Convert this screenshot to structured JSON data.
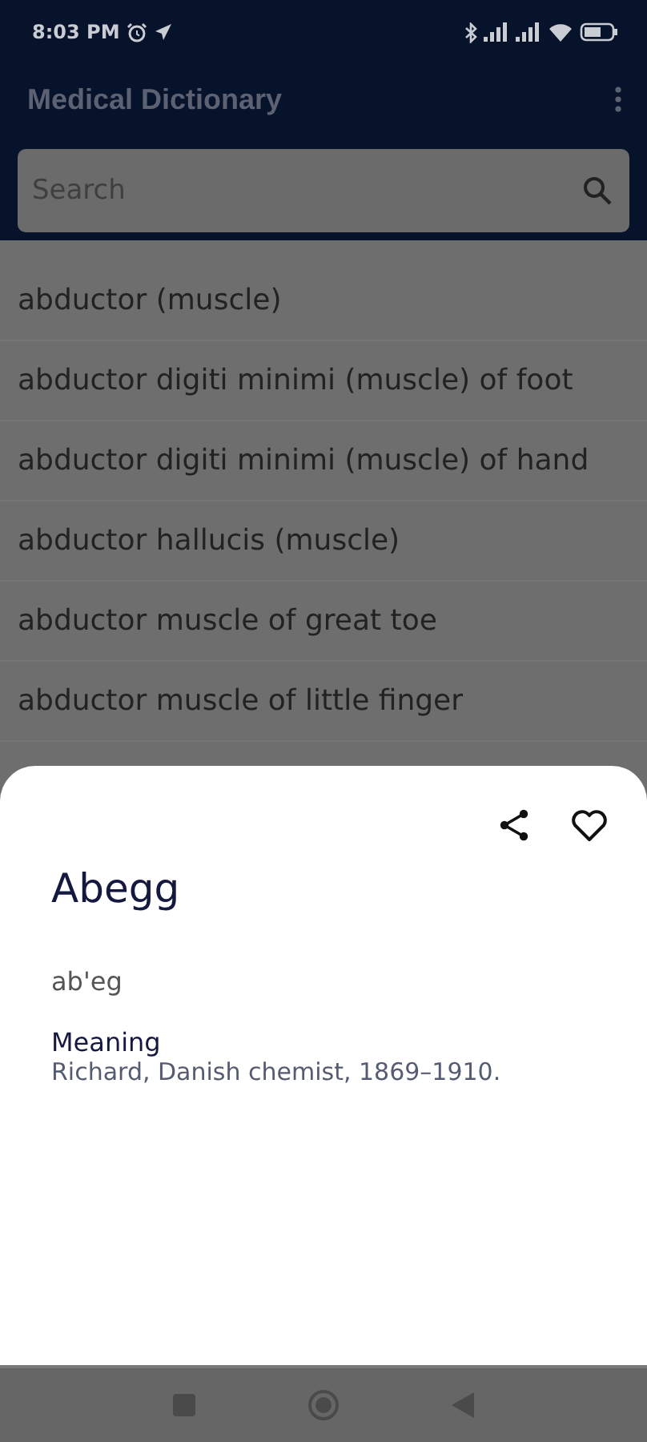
{
  "status_bar": {
    "time": "8:03 PM"
  },
  "app_bar": {
    "title": "Medical Dictionary"
  },
  "search": {
    "placeholder": "Search"
  },
  "entries": [
    "abductor (muscle)",
    "abductor digiti minimi (muscle) of foot",
    "abductor digiti minimi (muscle) of hand",
    "abductor hallucis (muscle)",
    "abductor muscle of great toe",
    "abductor muscle of little finger"
  ],
  "detail_sheet": {
    "term": "Abegg",
    "pronunciation": "ab'eg",
    "meaning_label": "Meaning",
    "meaning": "Richard, Danish chemist, 1869–1910.",
    "favorite": false
  }
}
